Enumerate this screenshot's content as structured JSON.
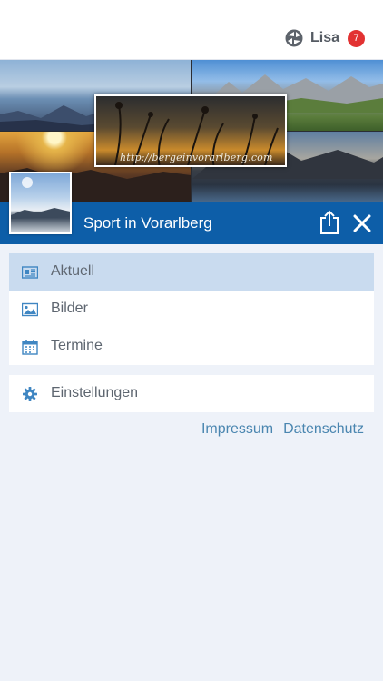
{
  "header": {
    "user_name": "Lisa",
    "notification_count": "7",
    "logo_icon": "app-logo-icon"
  },
  "cover": {
    "url_text": "http://bergeinvorarlberg.com"
  },
  "title_bar": {
    "title": "Sport in Vorarlberg",
    "share_icon": "share-icon",
    "close_icon": "close-icon",
    "color": "#0d5ea8"
  },
  "menu": {
    "items": [
      {
        "label": "Aktuell",
        "icon": "newspaper-icon",
        "active": true
      },
      {
        "label": "Bilder",
        "icon": "image-icon",
        "active": false
      },
      {
        "label": "Termine",
        "icon": "calendar-icon",
        "active": false
      }
    ],
    "settings": {
      "label": "Einstellungen",
      "icon": "gear-icon"
    }
  },
  "footer_links": {
    "impressum": "Impressum",
    "datenschutz": "Datenschutz"
  },
  "colors": {
    "accent": "#0d5ea8",
    "active_row": "#c9dbef",
    "badge": "#e23232",
    "link": "#4a86b0",
    "background": "#eef2f9"
  }
}
